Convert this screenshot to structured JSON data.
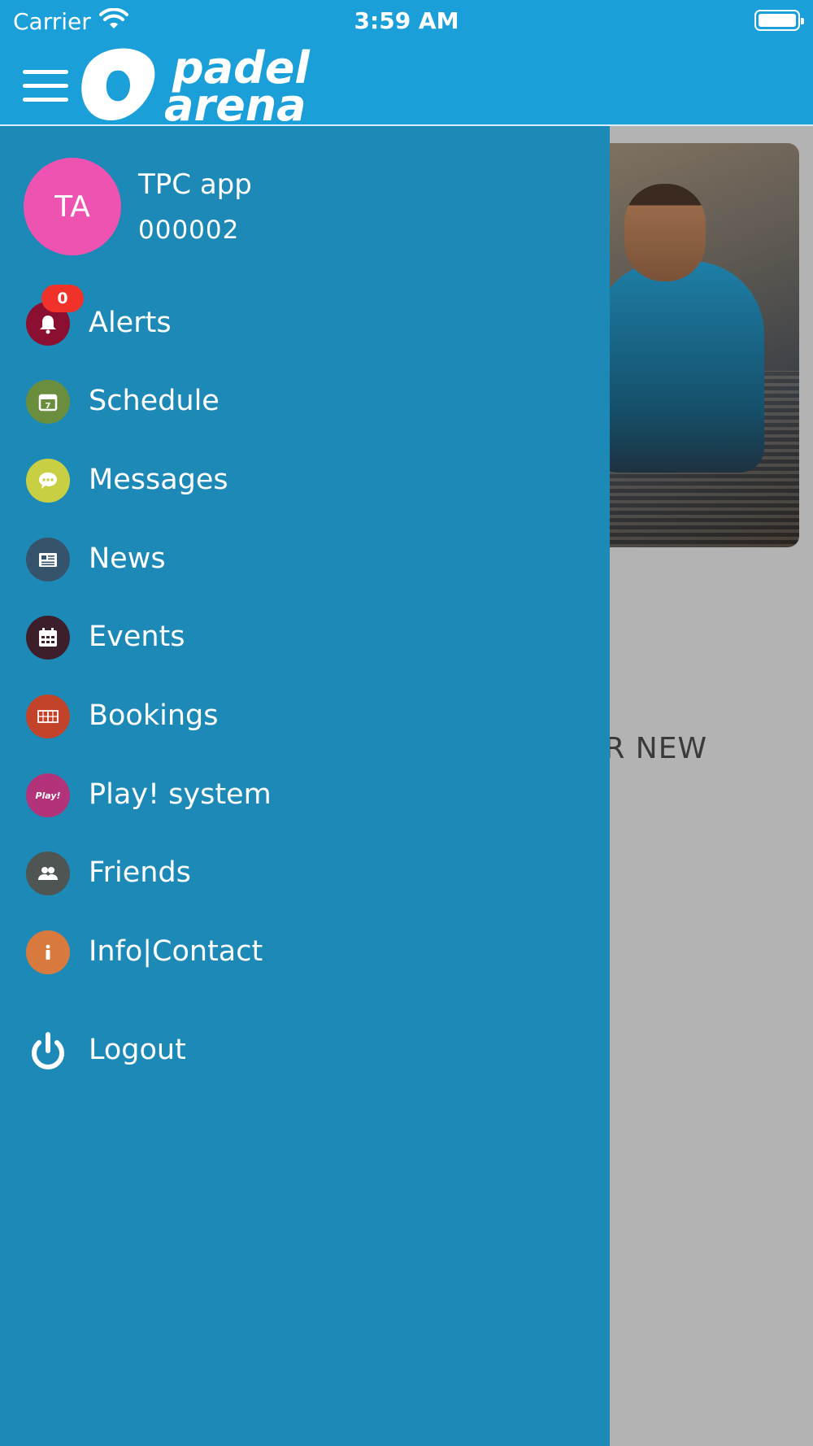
{
  "status_bar": {
    "carrier": "Carrier",
    "time": "3:59 AM"
  },
  "header": {
    "logo_line1": "padel",
    "logo_line2": "arena"
  },
  "background": {
    "promo_text": "UR NEW"
  },
  "user": {
    "initials": "TA",
    "name": "TPC app",
    "id": "000002"
  },
  "colors": {
    "header_blue": "#1b9fd8",
    "drawer_blue": "#1d89b7",
    "avatar_pink": "#ef53b2",
    "badge_red": "#f0322a"
  },
  "menu": {
    "items": [
      {
        "label": "Alerts",
        "icon": "bell-icon",
        "color": "#8b0f30",
        "badge": "0"
      },
      {
        "label": "Schedule",
        "icon": "calendar-day-icon",
        "color": "#6b8e3e"
      },
      {
        "label": "Messages",
        "icon": "chat-bubble-icon",
        "color": "#c9cf42"
      },
      {
        "label": "News",
        "icon": "newspaper-icon",
        "color": "#35536b"
      },
      {
        "label": "Events",
        "icon": "calendar-grid-icon",
        "color": "#3d1f2b"
      },
      {
        "label": "Bookings",
        "icon": "court-grid-icon",
        "color": "#c2432a"
      },
      {
        "label": "Play! system",
        "icon": "play-system-icon",
        "color": "#b2337a",
        "icon_text": "Play!"
      },
      {
        "label": "Friends",
        "icon": "friends-icon",
        "color": "#4e5552"
      },
      {
        "label": "Info|Contact",
        "icon": "info-icon",
        "color": "#d87a3e"
      }
    ],
    "logout": {
      "label": "Logout",
      "icon": "power-icon"
    }
  }
}
